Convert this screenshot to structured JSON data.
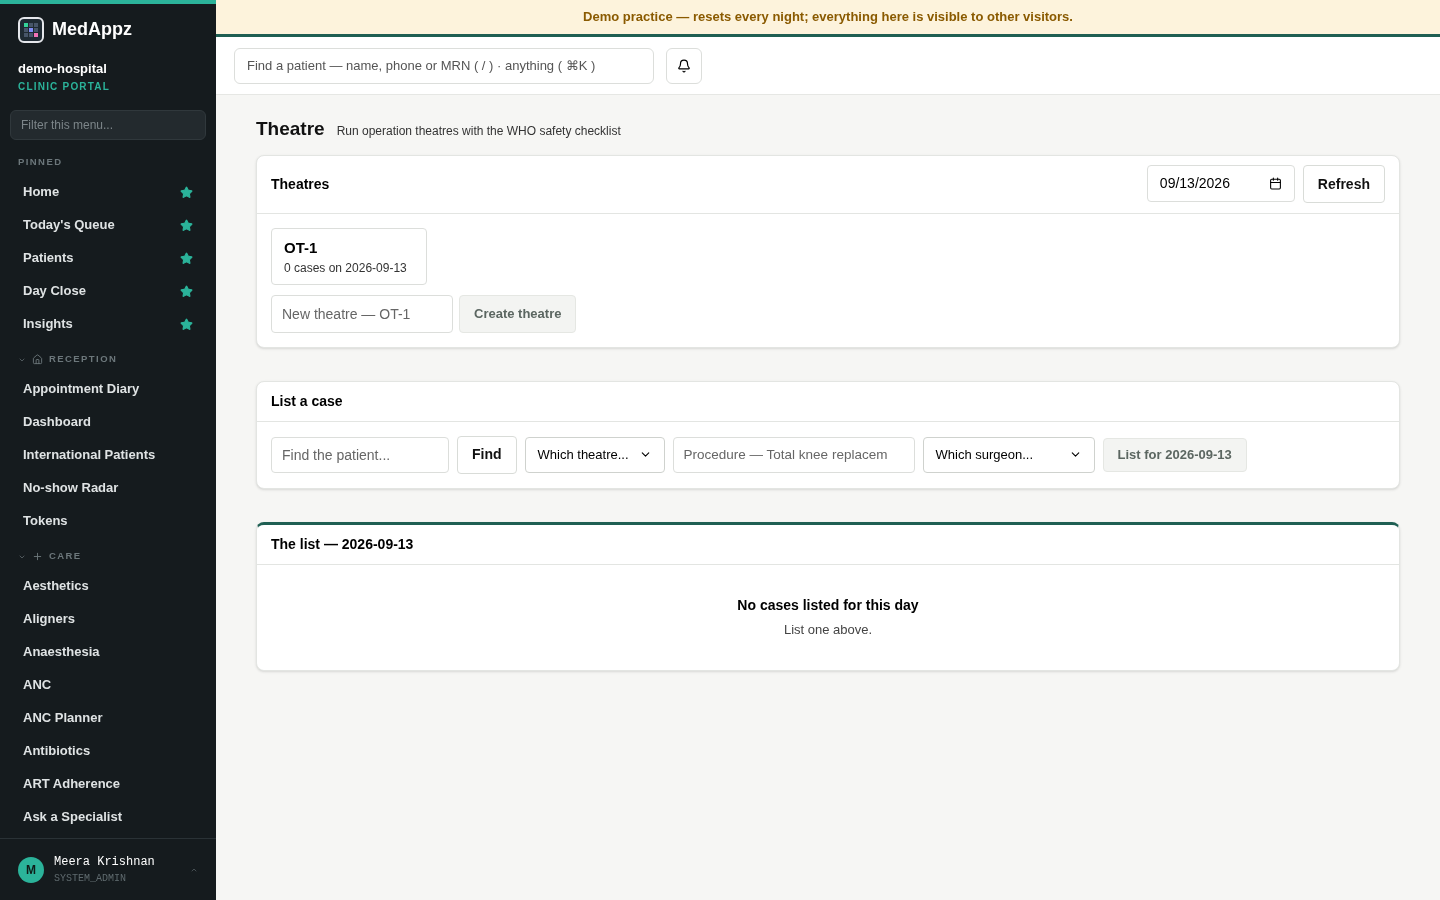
{
  "banner": "Demo practice — resets every night; everything here is visible to other visitors.",
  "sidebar": {
    "brand": "MedAppz",
    "org": "demo-hospital",
    "portal": "CLINIC PORTAL",
    "filter": {
      "placeholder": "Filter this menu..."
    },
    "sections": [
      {
        "title": "PINNED",
        "kind": "plain",
        "items": [
          {
            "label": "Home",
            "pinned": true
          },
          {
            "label": "Today's Queue",
            "pinned": true
          },
          {
            "label": "Patients",
            "pinned": true
          },
          {
            "label": "Day Close",
            "pinned": true
          },
          {
            "label": "Insights",
            "pinned": true
          }
        ]
      },
      {
        "title": "RECEPTION",
        "kind": "home",
        "items": [
          {
            "label": "Appointment Diary",
            "pinned": false
          },
          {
            "label": "Dashboard",
            "pinned": false
          },
          {
            "label": "International Patients",
            "pinned": false
          },
          {
            "label": "No-show Radar",
            "pinned": false
          },
          {
            "label": "Tokens",
            "pinned": false
          }
        ]
      },
      {
        "title": "CARE",
        "kind": "plus",
        "items": [
          {
            "label": "Aesthetics",
            "pinned": false
          },
          {
            "label": "Aligners",
            "pinned": false
          },
          {
            "label": "Anaesthesia",
            "pinned": false
          },
          {
            "label": "ANC",
            "pinned": false
          },
          {
            "label": "ANC Planner",
            "pinned": false
          },
          {
            "label": "Antibiotics",
            "pinned": false
          },
          {
            "label": "ART Adherence",
            "pinned": false
          },
          {
            "label": "Ask a Specialist",
            "pinned": false
          }
        ]
      }
    ],
    "user": {
      "initial": "M",
      "name": "Meera Krishnan",
      "role": "SYSTEM_ADMIN"
    }
  },
  "search": {
    "placeholder": "Find a patient — name, phone or MRN ( / ) · anything ( ⌘K )"
  },
  "page": {
    "title": "Theatre",
    "subtitle": "Run operation theatres with the WHO safety checklist"
  },
  "theatres": {
    "title": "Theatres",
    "date": "09/13/2026",
    "refresh": "Refresh",
    "cards": [
      {
        "name": "OT-1",
        "cases": "0 cases on 2026-09-13"
      }
    ],
    "new": {
      "placeholder": "New theatre — OT-1"
    },
    "create": {
      "label": "Create theatre",
      "disabled": true
    }
  },
  "list_case": {
    "title": "List a case",
    "patient": {
      "placeholder": "Find the patient..."
    },
    "find": "Find",
    "theatre": "Which theatre...",
    "procedure": {
      "placeholder": "Procedure — Total knee replacem"
    },
    "surgeon": "Which surgeon...",
    "submit": {
      "label": "List for 2026-09-13",
      "disabled": true
    }
  },
  "the_list": {
    "title": "The list — 2026-09-13",
    "empty_title": "No cases listed for this day",
    "empty_hint": "List one above."
  }
}
